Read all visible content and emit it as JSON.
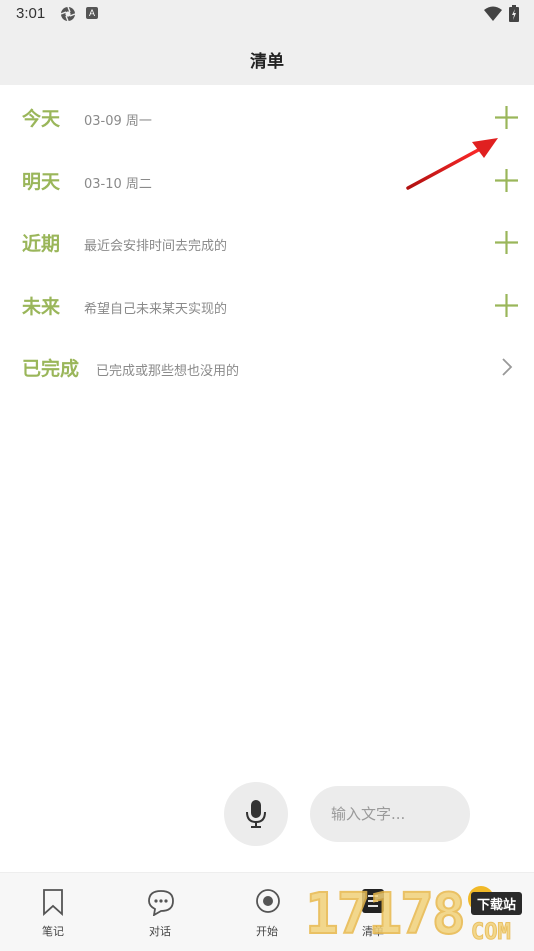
{
  "status_bar": {
    "time": "3:01",
    "letter_badge": "A"
  },
  "header": {
    "title": "清单"
  },
  "lists": [
    {
      "title": "今天",
      "subtitle": "03-09 周一",
      "action": "plus-icon"
    },
    {
      "title": "明天",
      "subtitle": "03-10 周二",
      "action": "plus-icon"
    },
    {
      "title": "近期",
      "subtitle": "最近会安排时间去完成的",
      "action": "plus-icon"
    },
    {
      "title": "未来",
      "subtitle": "希望自己未来某天实现的",
      "action": "plus-icon"
    },
    {
      "title": "已完成",
      "subtitle": "已完成或那些想也没用的",
      "action": "chevron-right-icon"
    }
  ],
  "input": {
    "placeholder": "输入文字..."
  },
  "tabs": [
    {
      "label": "笔记",
      "icon": "bookmark-icon"
    },
    {
      "label": "对话",
      "icon": "chat-bubble-icon"
    },
    {
      "label": "开始",
      "icon": "record-icon"
    },
    {
      "label": "清单",
      "icon": "list-icon",
      "active": true
    }
  ],
  "watermark": {
    "digits": "17178",
    "badge": "下载站",
    "suffix": "COM"
  },
  "colors": {
    "accent": "#9ab65a",
    "arrow": "#e02020",
    "background": "#efefef"
  }
}
